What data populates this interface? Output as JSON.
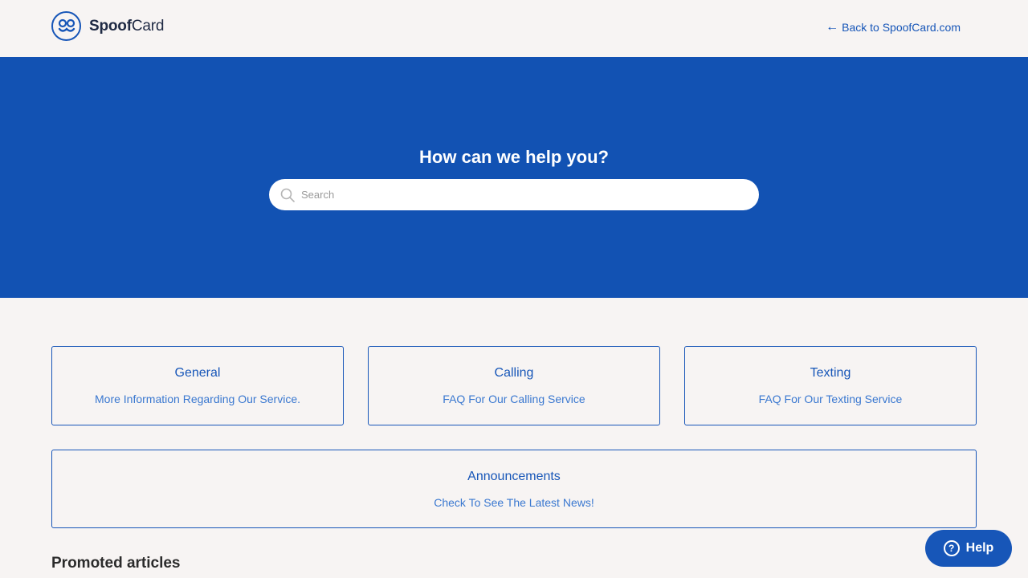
{
  "header": {
    "logo_bold": "Spoof",
    "logo_rest": "Card",
    "back_arrow": "←",
    "back_link": "Back to SpoofCard.com"
  },
  "hero": {
    "title": "How can we help you?",
    "search_placeholder": "Search",
    "search_value": ""
  },
  "categories": [
    {
      "title": "General",
      "description": "More Information Regarding Our Service."
    },
    {
      "title": "Calling",
      "description": "FAQ For Our Calling Service"
    },
    {
      "title": "Texting",
      "description": "FAQ For Our Texting Service"
    },
    {
      "title": "Announcements",
      "description": "Check To See The Latest News!"
    }
  ],
  "promoted": {
    "heading": "Promoted articles"
  },
  "help_widget": {
    "icon": "?",
    "label": "Help"
  },
  "colors": {
    "brand_blue": "#1252b3",
    "link_blue": "#1756b8",
    "background": "#f7f4f3"
  }
}
